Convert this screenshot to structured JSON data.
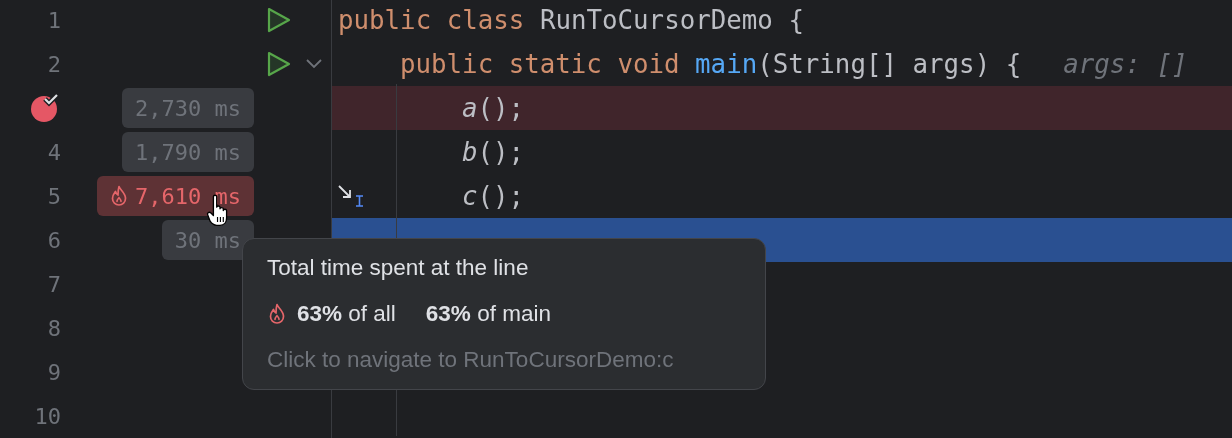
{
  "lines": [
    {
      "number": "1",
      "kind": "class",
      "run": true,
      "code": [
        {
          "kind": "keyword",
          "text": "public class "
        },
        {
          "kind": "plain",
          "text": "RunToCursorDemo {"
        }
      ]
    },
    {
      "number": "2",
      "kind": "method",
      "run": true,
      "run_menu": true,
      "code": [
        {
          "kind": "keyword",
          "text": "public static void "
        },
        {
          "kind": "method",
          "text": "main"
        },
        {
          "kind": "plain",
          "text": "(String[] args) {"
        }
      ],
      "hint": "args: []"
    },
    {
      "breakpoint": true,
      "kind": "statement",
      "timing": "2,730 ms",
      "hot": false,
      "code": [
        {
          "kind": "call",
          "text": "a"
        },
        {
          "kind": "plain",
          "text": "();"
        }
      ]
    },
    {
      "number": "4",
      "kind": "statement",
      "timing": "1,790 ms",
      "hot": false,
      "code": [
        {
          "kind": "call",
          "text": "b"
        },
        {
          "kind": "plain",
          "text": "();"
        }
      ]
    },
    {
      "number": "5",
      "kind": "statement",
      "timing": "7,610 ms",
      "hot": true,
      "run_to_cursor": true,
      "code": [
        {
          "kind": "call",
          "text": "c"
        },
        {
          "kind": "plain",
          "text": "();"
        }
      ]
    },
    {
      "number": "6",
      "kind": "statement",
      "timing": "30 ms",
      "hot": false,
      "current": true
    },
    {
      "number": "7"
    },
    {
      "number": "8"
    },
    {
      "number": "9"
    },
    {
      "number": "10"
    }
  ],
  "tooltip": {
    "title": "Total time spent at the line",
    "stats": [
      "**63%** of all",
      "**63%** of main"
    ],
    "footer": "Click to navigate to RunToCursorDemo:c"
  }
}
